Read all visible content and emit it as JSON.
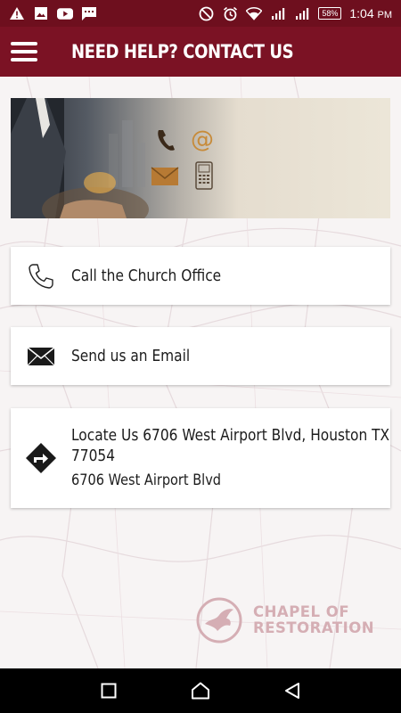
{
  "status_bar": {
    "icons_left": [
      "warning-icon",
      "image-icon",
      "youtube-icon",
      "message-icon"
    ],
    "icons_right": [
      "do-not-disturb-icon",
      "alarm-icon",
      "wifi-icon",
      "signal-icon",
      "signal-icon-2"
    ],
    "battery": "58",
    "time": "1:04",
    "time_suffix": "PM"
  },
  "app_bar": {
    "title": "NEED HELP? CONTACT US",
    "menu_icon": "hamburger-menu-icon",
    "color": "#7b1224"
  },
  "contacts": {
    "call_label": "Call the Church Office",
    "email_label": "Send us an Email",
    "locate_label_line1": "Locate Us 6706 West Airport Blvd, Houston TX",
    "locate_label_line2": "77054",
    "locate_address": "6706 West Airport Blvd"
  },
  "logo": {
    "line1": "CHAPEL OF",
    "line2": "RESTORATION",
    "color": "#d5aeb4"
  },
  "nav_bar": {
    "icons": [
      "recents-square-icon",
      "home-icon",
      "back-triangle-icon"
    ]
  }
}
